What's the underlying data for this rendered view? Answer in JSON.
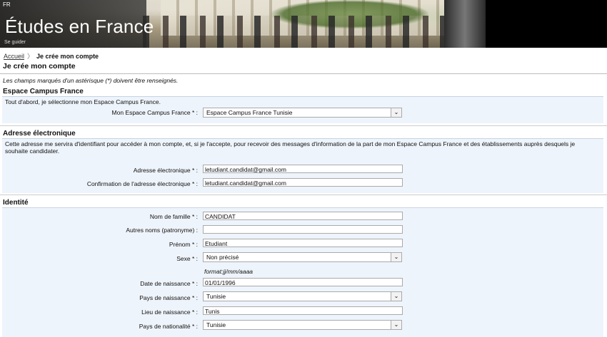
{
  "header": {
    "lang": "FR",
    "site_title": "Études en France",
    "subtitle": "Se guider"
  },
  "breadcrumb": {
    "home": "Accueil",
    "current": "Je crée mon compte"
  },
  "page": {
    "title": "Je crée mon compte",
    "required_note": "Les champs marqués d'un astérisque (*) doivent être renseignés."
  },
  "campus": {
    "title": "Espace Campus France",
    "intro": "Tout d'abord, je sélectionne mon Espace Campus France.",
    "field_label": "Mon Espace Campus France * :",
    "field_value": "Espace Campus France Tunisie"
  },
  "email": {
    "title": "Adresse électronique",
    "intro": "Cette adresse me servira d'identifiant pour accéder à mon compte, et, si je l'accepte, pour recevoir des messages d'information de la part de mon Espace Campus France et des établissements auprès desquels je souhaite candidater.",
    "email_label": "Adresse électronique * :",
    "email_value": "letudiant.candidat@gmail.com",
    "confirm_label": "Confirmation de l'adresse électronique * :",
    "confirm_value": "letudiant.candidat@gmail.com"
  },
  "identity": {
    "title": "Identité",
    "lastname_label": "Nom de famille * :",
    "lastname_value": "CANDIDAT",
    "othernames_label": "Autres noms (patronyme) :",
    "othernames_value": "",
    "firstname_label": "Prénom * :",
    "firstname_value": "Etudiant",
    "sex_label": "Sexe * :",
    "sex_value": "Non précisé",
    "date_hint": "format:jj/mm/aaaa",
    "birthdate_label": "Date de naissance * :",
    "birthdate_value": "01/01/1996",
    "birthcountry_label": "Pays de naissance * :",
    "birthcountry_value": "Tunisie",
    "birthplace_label": "Lieu de naissance * :",
    "birthplace_value": "Tunis",
    "nationality_label": "Pays de nationalité * :",
    "nationality_value": "Tunisie"
  }
}
